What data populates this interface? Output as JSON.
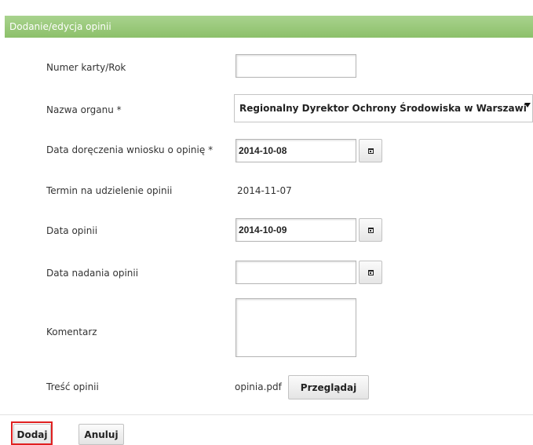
{
  "header": {
    "title": "Dodanie/edycja opinii"
  },
  "form": {
    "card_number": {
      "label": "Numer karty/Rok",
      "value": ""
    },
    "organ_name": {
      "label": "Nazwa organu *",
      "value": "Regionalny Dyrektor Ochrony Środowiska w Warszawi"
    },
    "delivery_date": {
      "label": "Data doręczenia wniosku o opinię *",
      "value": "2014-10-08"
    },
    "deadline": {
      "label": "Termin na udzielenie opinii",
      "value": "2014-11-07"
    },
    "opinion_date": {
      "label": "Data opinii",
      "value": "2014-10-09"
    },
    "send_date": {
      "label": "Data nadania opinii",
      "value": ""
    },
    "comment": {
      "label": "Komentarz",
      "value": ""
    },
    "content": {
      "label": "Treść opinii",
      "file_name": "opinia.pdf",
      "browse_label": "Przeglądaj"
    }
  },
  "actions": {
    "add_label": "Dodaj",
    "cancel_label": "Anuluj"
  },
  "colors": {
    "header": "#8cc06a",
    "highlight": "#e02020"
  },
  "icons": {
    "calendar": "calendar-icon",
    "dropdown": "chevron-down-icon"
  }
}
